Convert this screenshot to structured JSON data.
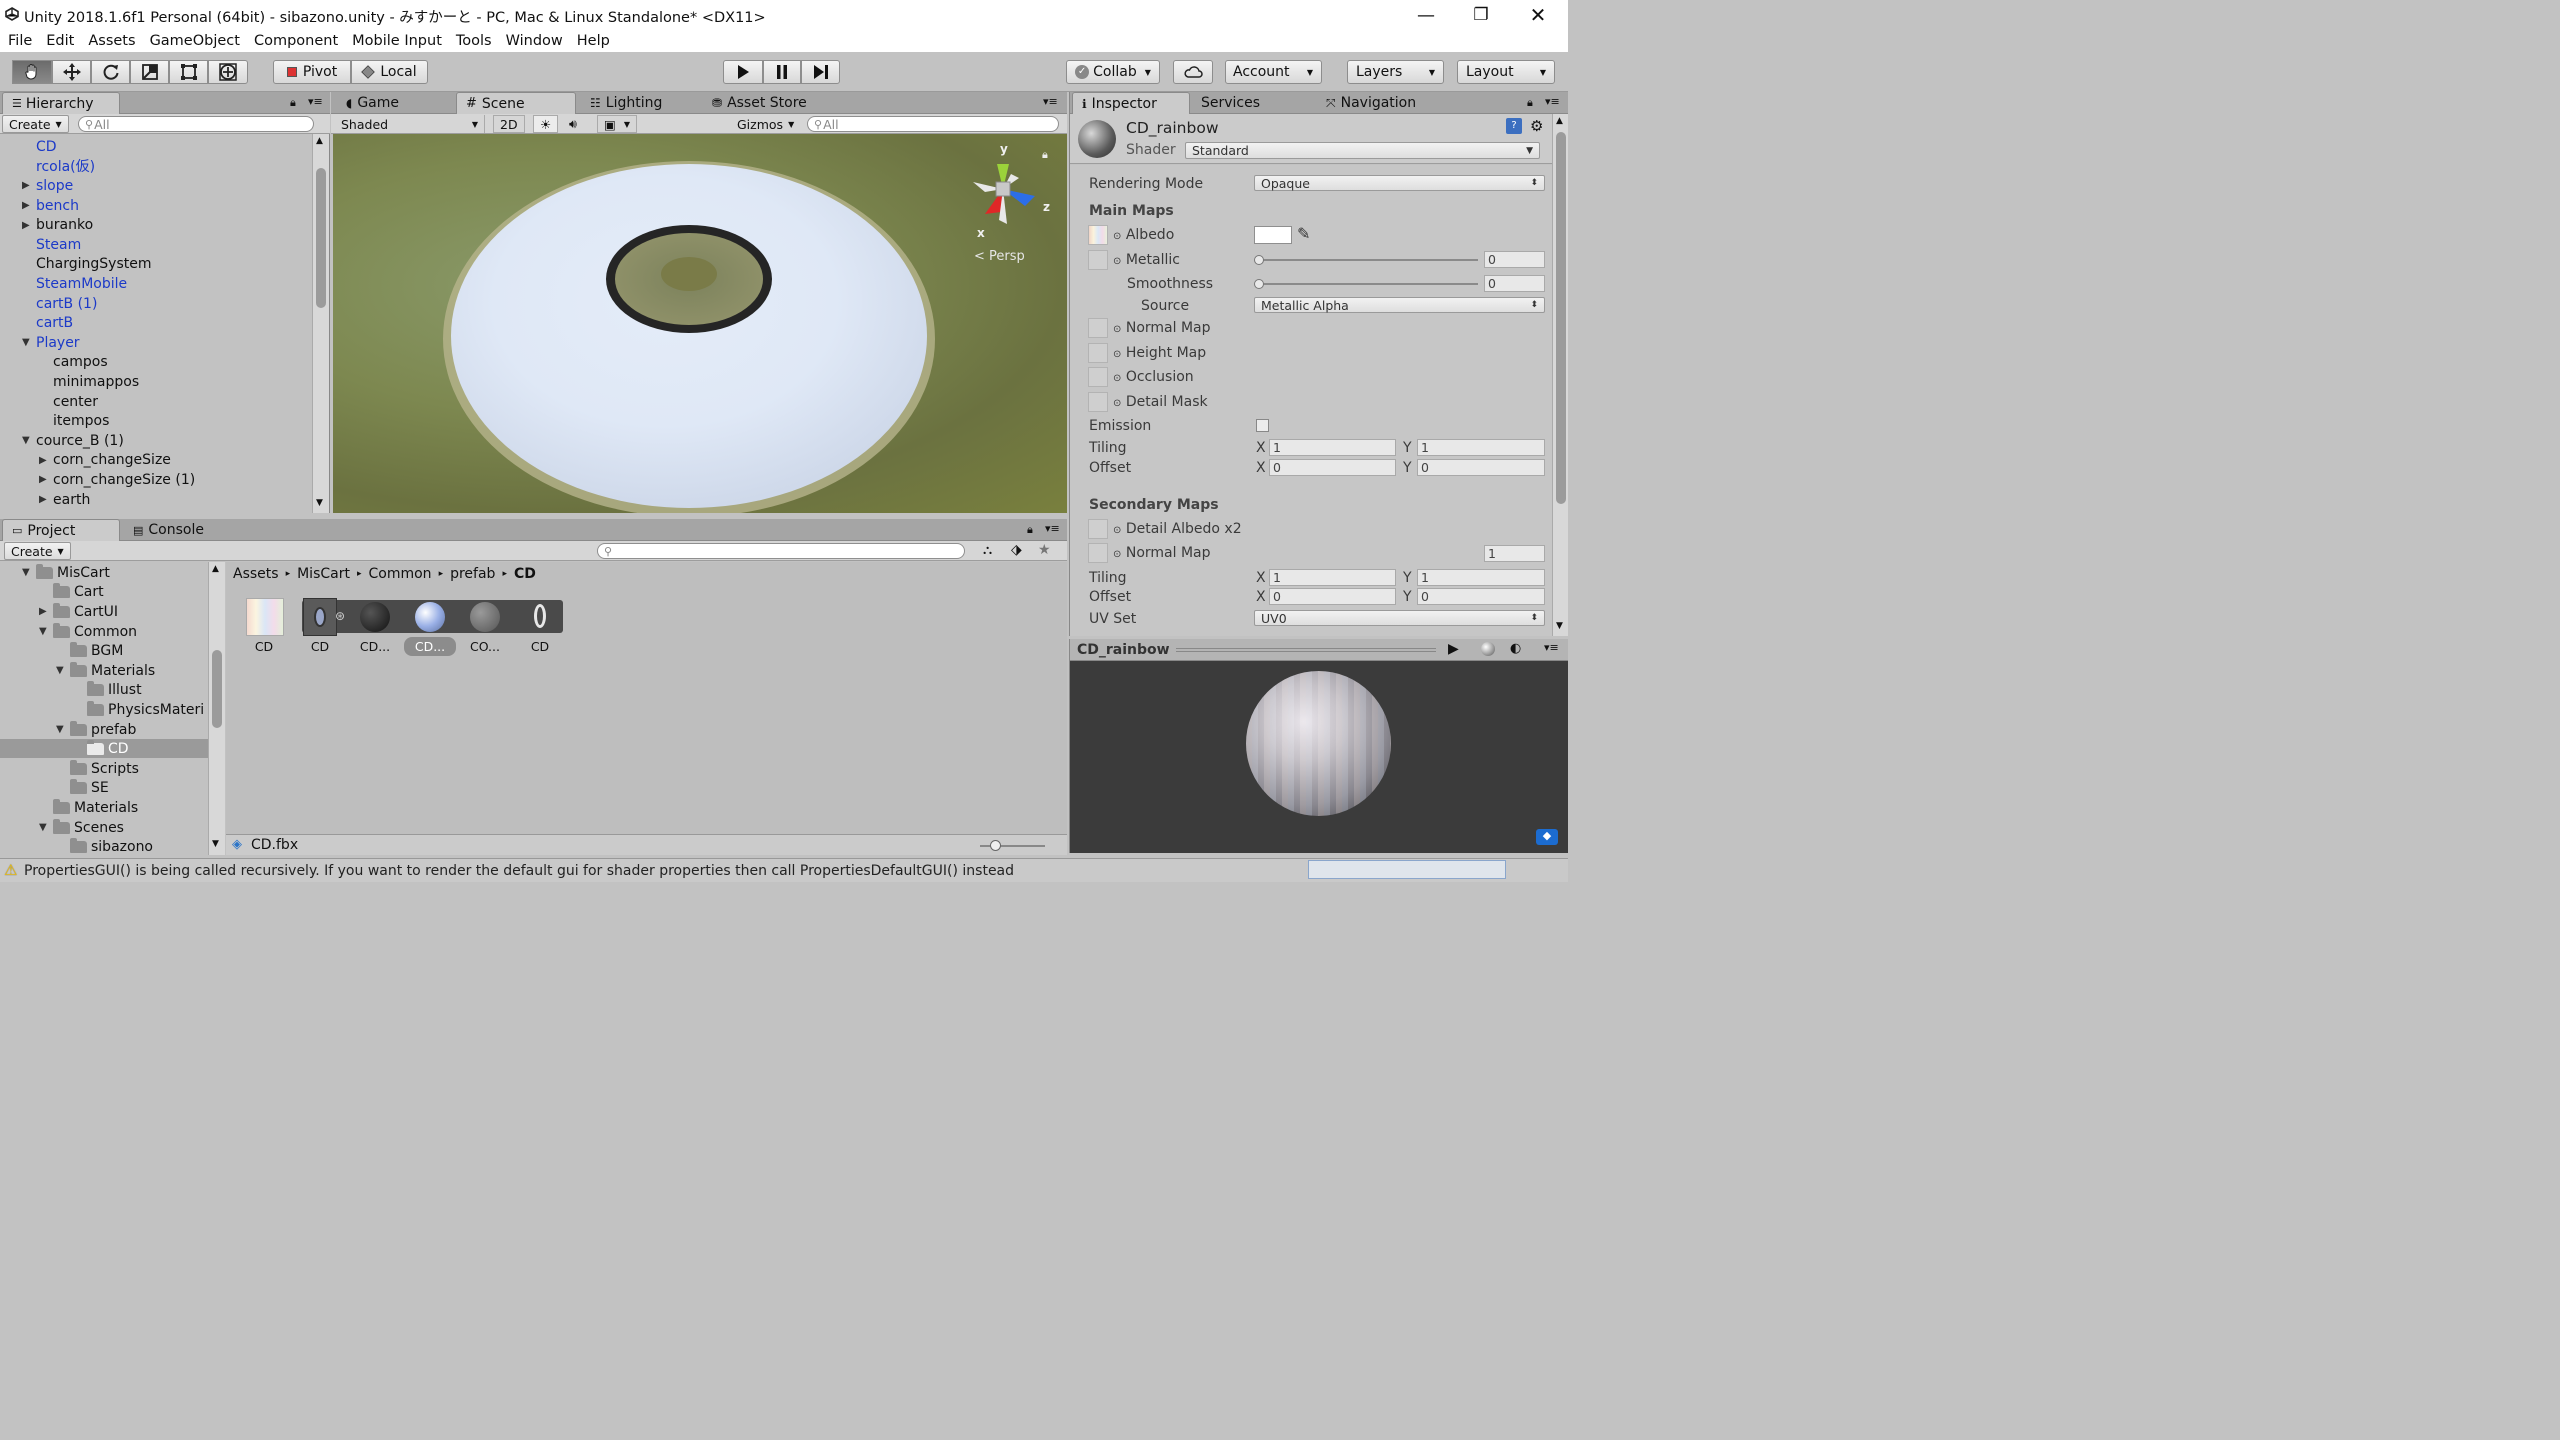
{
  "window": {
    "title": "Unity 2018.1.6f1 Personal (64bit) - sibazono.unity - みすかーと - PC, Mac & Linux Standalone* <DX11>",
    "controls": [
      "—",
      "❐",
      "✕"
    ]
  },
  "menu": [
    "File",
    "Edit",
    "Assets",
    "GameObject",
    "Component",
    "Mobile Input",
    "Tools",
    "Window",
    "Help"
  ],
  "toolbar": {
    "pivot": "Pivot",
    "local": "Local",
    "collab": "Collab",
    "account": "Account",
    "layers": "Layers",
    "layout": "Layout"
  },
  "hierarchy": {
    "tab": "Hierarchy",
    "create": "Create",
    "search_placeholder": "All",
    "items": [
      {
        "label": "CD",
        "blue": true,
        "arrow": "",
        "indent": 0
      },
      {
        "label": "rcola(仮)",
        "blue": true,
        "arrow": "",
        "indent": 0
      },
      {
        "label": "slope",
        "blue": true,
        "arrow": "right",
        "indent": 0
      },
      {
        "label": "bench",
        "blue": true,
        "arrow": "right",
        "indent": 0
      },
      {
        "label": "buranko",
        "blue": false,
        "arrow": "right",
        "indent": 0
      },
      {
        "label": "Steam",
        "blue": true,
        "arrow": "",
        "indent": 0
      },
      {
        "label": "ChargingSystem",
        "blue": false,
        "arrow": "",
        "indent": 0
      },
      {
        "label": "SteamMobile",
        "blue": true,
        "arrow": "",
        "indent": 0
      },
      {
        "label": "cartB (1)",
        "blue": true,
        "arrow": "",
        "indent": 0
      },
      {
        "label": "cartB",
        "blue": true,
        "arrow": "",
        "indent": 0
      },
      {
        "label": "Player",
        "blue": true,
        "arrow": "down",
        "indent": 0
      },
      {
        "label": "campos",
        "blue": false,
        "arrow": "",
        "indent": 1
      },
      {
        "label": "minimappos",
        "blue": false,
        "arrow": "",
        "indent": 1
      },
      {
        "label": "center",
        "blue": false,
        "arrow": "",
        "indent": 1
      },
      {
        "label": "itempos",
        "blue": false,
        "arrow": "",
        "indent": 1
      },
      {
        "label": "cource_B (1)",
        "blue": false,
        "arrow": "down",
        "indent": 0
      },
      {
        "label": "corn_changeSize",
        "blue": false,
        "arrow": "right",
        "indent": 1
      },
      {
        "label": "corn_changeSize (1)",
        "blue": false,
        "arrow": "right",
        "indent": 1
      },
      {
        "label": "earth",
        "blue": false,
        "arrow": "right",
        "indent": 1
      }
    ]
  },
  "scene": {
    "tabs": [
      "Game",
      "Scene",
      "Lighting",
      "Asset Store"
    ],
    "shading": "Shaded",
    "mode2d": "2D",
    "gizmos": "Gizmos",
    "search_placeholder": "All",
    "gizmo_labels": {
      "y": "y",
      "z": "z",
      "x": "x",
      "persp": "Persp"
    }
  },
  "inspector": {
    "tabs": [
      "Inspector",
      "Services",
      "Navigation"
    ],
    "material_name": "CD_rainbow",
    "shader_label": "Shader",
    "shader_value": "Standard",
    "rendering_mode_label": "Rendering Mode",
    "rendering_mode_value": "Opaque",
    "main_maps": "Main Maps",
    "albedo": "Albedo",
    "metallic": "Metallic",
    "metallic_value": "0",
    "smoothness": "Smoothness",
    "smoothness_value": "0",
    "source": "Source",
    "source_value": "Metallic Alpha",
    "normal_map": "Normal Map",
    "height_map": "Height Map",
    "occlusion": "Occlusion",
    "detail_mask": "Detail Mask",
    "emission": "Emission",
    "tiling": "Tiling",
    "offset": "Offset",
    "axis_x": "X",
    "axis_y": "Y",
    "tiling_x": "1",
    "tiling_y": "1",
    "offset_x": "0",
    "offset_y": "0",
    "secondary_maps": "Secondary Maps",
    "detail_albedo": "Detail Albedo x2",
    "normal_map2": "Normal Map",
    "normal_map2_value": "1",
    "tiling2_x": "1",
    "tiling2_y": "1",
    "offset2_x": "0",
    "offset2_y": "0",
    "uv_set": "UV Set",
    "uv_set_value": "UV0",
    "preview_title": "CD_rainbow"
  },
  "project": {
    "tabs": [
      "Project",
      "Console"
    ],
    "create": "Create",
    "breadcrumb": [
      "Assets",
      "MisCart",
      "Common",
      "prefab",
      "CD"
    ],
    "tree": [
      {
        "label": "MisCart",
        "indent": 0,
        "arrow": "down"
      },
      {
        "label": "Cart",
        "indent": 1,
        "arrow": ""
      },
      {
        "label": "CartUI",
        "indent": 1,
        "arrow": "right"
      },
      {
        "label": "Common",
        "indent": 1,
        "arrow": "down"
      },
      {
        "label": "BGM",
        "indent": 2,
        "arrow": ""
      },
      {
        "label": "Materials",
        "indent": 2,
        "arrow": "down"
      },
      {
        "label": "Illust",
        "indent": 3,
        "arrow": ""
      },
      {
        "label": "PhysicsMateri",
        "indent": 3,
        "arrow": ""
      },
      {
        "label": "prefab",
        "indent": 2,
        "arrow": "down"
      },
      {
        "label": "CD",
        "indent": 3,
        "arrow": "",
        "selected": true
      },
      {
        "label": "Scripts",
        "indent": 2,
        "arrow": ""
      },
      {
        "label": "SE",
        "indent": 2,
        "arrow": ""
      },
      {
        "label": "Materials",
        "indent": 1,
        "arrow": ""
      },
      {
        "label": "Scenes",
        "indent": 1,
        "arrow": "down"
      },
      {
        "label": "sibazono",
        "indent": 2,
        "arrow": ""
      }
    ],
    "assets": [
      "CD",
      "CD",
      "CD...",
      "CD...",
      "CO...",
      "CD"
    ],
    "footer_file": "CD.fbx"
  },
  "status": {
    "message": "PropertiesGUI() is being called recursively. If you want to render the default gui for shader properties then call PropertiesDefaultGUI() instead"
  },
  "colors": {
    "accent_blue": "#1c3ac8",
    "panel_bg": "#c2c2c2",
    "warning": "#f5c400"
  }
}
